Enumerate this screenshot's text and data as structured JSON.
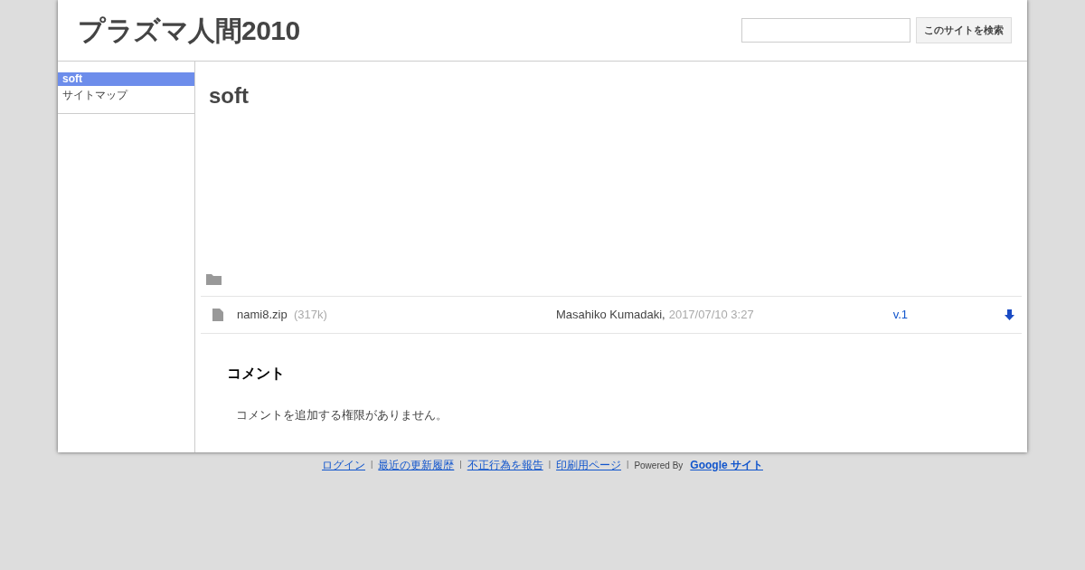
{
  "site_title": "プラズマ人間2010",
  "search": {
    "button": "このサイトを検索"
  },
  "sidebar": {
    "items": [
      {
        "label": "soft",
        "selected": true
      },
      {
        "label": "サイトマップ",
        "selected": false
      }
    ]
  },
  "page": {
    "title": "soft",
    "files": [
      {
        "name": "nami8.zip",
        "size": "(317k)",
        "author": "Masahiko Kumadaki,",
        "date": "2017/07/10 3:27",
        "version": "v.1"
      }
    ],
    "comments": {
      "heading": "コメント",
      "message": "コメントを追加する権限がありません。"
    }
  },
  "footer": {
    "items": [
      {
        "kind": "link",
        "text": "ログイン"
      },
      {
        "kind": "separator",
        "text": "|"
      },
      {
        "kind": "link",
        "text": "最近の更新履歴"
      },
      {
        "kind": "separator",
        "text": "|"
      },
      {
        "kind": "link",
        "text": "不正行為を報告"
      },
      {
        "kind": "separator",
        "text": "|"
      },
      {
        "kind": "link",
        "text": "印刷用ページ"
      },
      {
        "kind": "separator",
        "text": "|"
      },
      {
        "kind": "text",
        "text": "Powered By"
      },
      {
        "kind": "brand",
        "text": "Google サイト"
      }
    ]
  }
}
